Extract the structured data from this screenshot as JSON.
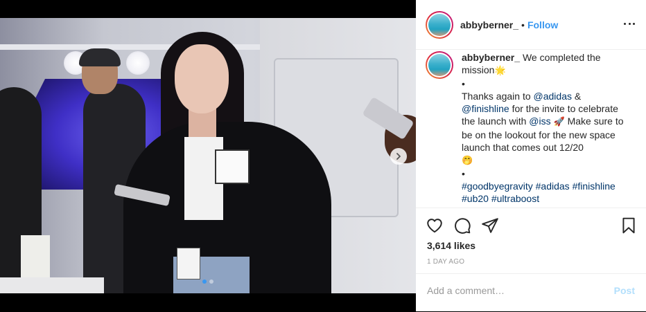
{
  "header": {
    "username": "abbyberner_",
    "separator": "•",
    "follow_label": "Follow"
  },
  "caption": {
    "username": "abbyberner_",
    "line1": "We completed the mission",
    "emoji_star": "🌟",
    "bullet": "•",
    "thanks_prefix": "Thanks again to ",
    "mention_adidas": "@adidas",
    "amp": " &",
    "mention_finishline": "@finishline",
    "invite_text": " for the invite to celebrate the launch with ",
    "mention_iss": "@iss",
    "emoji_rocket": "🚀",
    "lookout_text": " Make sure to be on the lookout for the new space launch that comes out 12/20",
    "emoji_face": "🤭",
    "bullet2": "•",
    "hashtags": [
      "#goodbyegravity",
      "#adidas",
      "#finishline",
      "#ub20",
      "#ultraboost"
    ]
  },
  "stats": {
    "likes": "3,614 likes",
    "time": "1 DAY AGO"
  },
  "comment_box": {
    "placeholder": "Add a comment…",
    "post_label": "Post"
  },
  "carousel": {
    "slide_count": 2,
    "active_index": 0
  },
  "colors": {
    "link": "#003569",
    "follow": "#3897f0",
    "post_disabled": "#b2dffc",
    "muted": "#999999"
  }
}
